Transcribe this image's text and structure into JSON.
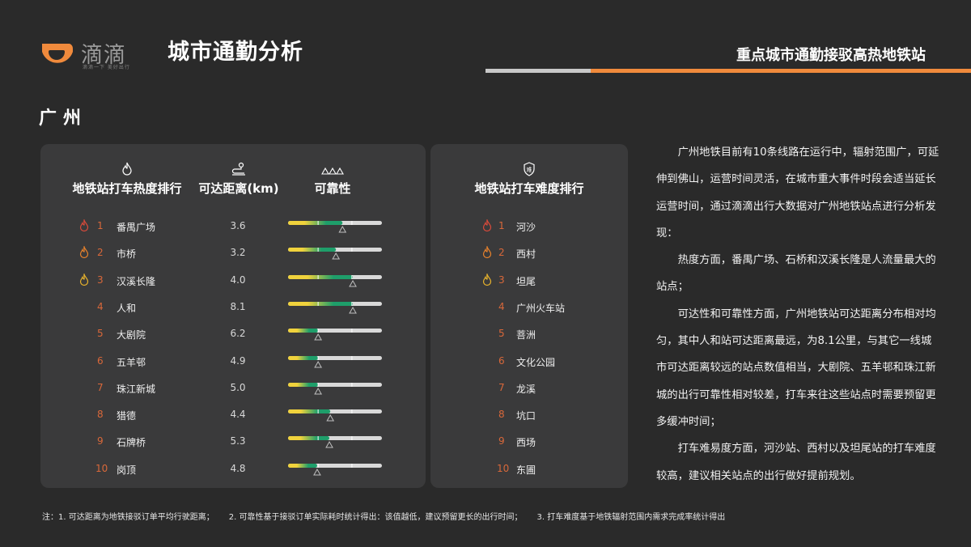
{
  "header": {
    "logo_text": "滴滴",
    "logo_slogan": "滴滴一下 美好出行",
    "title": "城市通勤分析",
    "subtitle": "重点城市通勤接驳高热地铁站"
  },
  "colors": {
    "accent_orange": "#f08a3c",
    "rank_red": "#d9683a",
    "fire_red": "#d94a3a",
    "fire_orange": "#e8822c",
    "fire_yellow": "#e8b32c",
    "bar_green": "#1e9e6a",
    "bar_yellow": "#f0d23c",
    "bar_track": "#d9d9d9"
  },
  "city": "广州",
  "heat_table": {
    "headers": {
      "ranking": "地铁站打车热度排行",
      "distance": "可达距离(km)",
      "reliability": "可靠性"
    },
    "icons": {
      "ranking": "fire-icon",
      "distance": "route-icon",
      "reliability": "triangles-icon"
    },
    "rows": [
      {
        "rank": "1",
        "station": "番禺广场",
        "distance": "3.6",
        "reliability": 0.58,
        "fire": "red"
      },
      {
        "rank": "2",
        "station": "市桥",
        "distance": "3.2",
        "reliability": 0.51,
        "fire": "orange"
      },
      {
        "rank": "3",
        "station": "汉溪长隆",
        "distance": "4.0",
        "reliability": 0.69,
        "fire": "yellow"
      },
      {
        "rank": "4",
        "station": "人和",
        "distance": "8.1",
        "reliability": 0.69,
        "fire": ""
      },
      {
        "rank": "5",
        "station": "大剧院",
        "distance": "6.2",
        "reliability": 0.32,
        "fire": ""
      },
      {
        "rank": "6",
        "station": "五羊邨",
        "distance": "4.9",
        "reliability": 0.32,
        "fire": ""
      },
      {
        "rank": "7",
        "station": "珠江新城",
        "distance": "5.0",
        "reliability": 0.32,
        "fire": ""
      },
      {
        "rank": "8",
        "station": "猎德",
        "distance": "4.4",
        "reliability": 0.45,
        "fire": ""
      },
      {
        "rank": "9",
        "station": "石牌桥",
        "distance": "5.3",
        "reliability": 0.44,
        "fire": ""
      },
      {
        "rank": "10",
        "station": "岗顶",
        "distance": "4.8",
        "reliability": 0.31,
        "fire": ""
      }
    ]
  },
  "difficulty_table": {
    "header": "地铁站打车难度排行",
    "icon": "shield-difficulty-icon",
    "rows": [
      {
        "rank": "1",
        "station": "河沙",
        "fire": "red"
      },
      {
        "rank": "2",
        "station": "西村",
        "fire": "orange"
      },
      {
        "rank": "3",
        "station": "坦尾",
        "fire": "yellow"
      },
      {
        "rank": "4",
        "station": "广州火车站",
        "fire": ""
      },
      {
        "rank": "5",
        "station": "菩洲",
        "fire": ""
      },
      {
        "rank": "6",
        "station": "文化公园",
        "fire": ""
      },
      {
        "rank": "7",
        "station": "龙溪",
        "fire": ""
      },
      {
        "rank": "8",
        "station": "坑口",
        "fire": ""
      },
      {
        "rank": "9",
        "station": "西场",
        "fire": ""
      },
      {
        "rank": "10",
        "station": "东圃",
        "fire": ""
      }
    ]
  },
  "description": [
    "广州地铁目前有10条线路在运行中，辐射范围广，可延伸到佛山，运营时间灵活，在城市重大事件时段会适当延长运营时间，通过滴滴出行大数据对广州地铁站点进行分析发现：",
    "热度方面，番禺广场、石桥和汉溪长隆是人流量最大的站点；",
    "可达性和可靠性方面，广州地铁站可达距离分布相对均匀，其中人和站可达距离最远，为8.1公里，与其它一线城市可达距离较远的站点数值相当，大剧院、五羊邨和珠江新城的出行可靠性相对较差，打车来往这些站点时需要预留更多缓冲时间；",
    "打车难易度方面，河沙站、西村以及坦尾站的打车难度较高，建议相关站点的出行做好提前规划。"
  ],
  "footnotes": [
    "注：1. 可达距离为地铁接驳订单平均行驶距离；",
    "2. 可靠性基于接驳订单实际耗时统计得出：该值越低，建议预留更长的出行时间；",
    "3. 打车难度基于地铁辐射范围内需求完成率统计得出"
  ]
}
